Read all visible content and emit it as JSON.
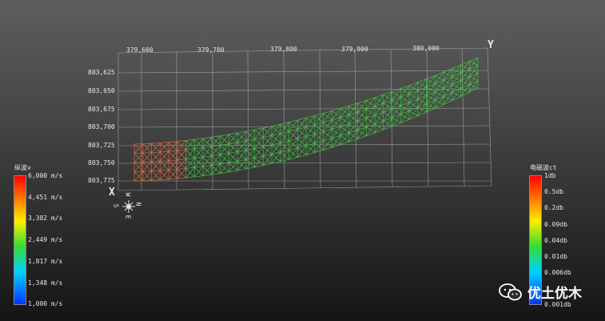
{
  "axes": {
    "y_label": "Y",
    "x_label": "X",
    "top_ticks": [
      "379,600",
      "379,700",
      "379,800",
      "379,900",
      "380,000"
    ],
    "left_ticks": [
      "803,625",
      "803,650",
      "803,675",
      "803,700",
      "803,725",
      "803,750",
      "803,775"
    ]
  },
  "compass": {
    "n": "N",
    "s": "S",
    "e": "E",
    "w": "W"
  },
  "legend_left": {
    "title": "纵波v",
    "labels": [
      "6,000 m/s",
      "4,451 m/s",
      "3,382 m/s",
      "2,449 m/s",
      "1,817 m/s",
      "1,348 m/s",
      "1,000 m/s"
    ]
  },
  "legend_right": {
    "title": "电磁波ct",
    "labels": [
      "1db",
      "0.5db",
      "0.2db",
      "0.09db",
      "0.04db",
      "0.01db",
      "0.006db",
      "0.001db"
    ]
  },
  "watermark": {
    "text": "优土优木",
    "icon": "wechat-icon"
  },
  "colors": {
    "mesh_green": "#3fc43f",
    "mesh_orange": "#d86a3a",
    "grid": "#bfbfbf"
  }
}
